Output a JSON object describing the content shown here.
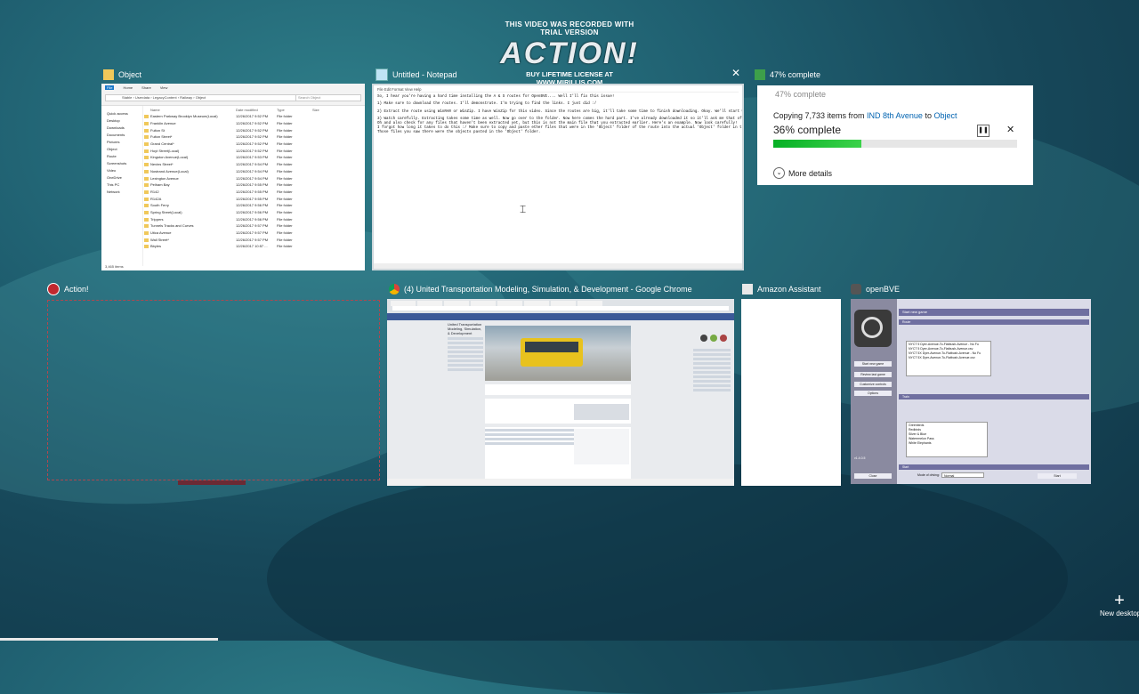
{
  "watermark": {
    "line1": "THIS VIDEO WAS RECORDED WITH TRIAL VERSION",
    "logo": "ACTION!",
    "line2": "BUY LIFETIME LICENSE AT WWW.MIRILLIS.COM"
  },
  "windows": {
    "explorer": {
      "title": "Object",
      "tabs": [
        "File",
        "Home",
        "Share",
        "View"
      ],
      "path": "Stable › Userdata › LegacyContent › Railway › Object",
      "search_placeholder": "Search Object",
      "sidebar": [
        "Quick access",
        "Desktop",
        "Downloads",
        "Documents",
        "Pictures",
        "Object",
        "Route",
        "Screenshots",
        "Video",
        "OneDrive",
        "This PC",
        "Network"
      ],
      "columns": [
        "Name",
        "Date modified",
        "Type",
        "Size"
      ],
      "rows": [
        [
          "Eastern Parkway Brooklyn Museum(Local)",
          "12/26/2017 9:52 PM",
          "File folder"
        ],
        [
          "Franklin Avenue",
          "12/26/2017 9:52 PM",
          "File folder"
        ],
        [
          "Fulton St",
          "12/26/2017 9:52 PM",
          "File folder"
        ],
        [
          "Fulton Street*",
          "12/26/2017 9:52 PM",
          "File folder"
        ],
        [
          "Grand Central*",
          "12/26/2017 9:52 PM",
          "File folder"
        ],
        [
          "Hoyt Street(Local)",
          "12/26/2017 9:52 PM",
          "File folder"
        ],
        [
          "Kingston Avenue(Local)",
          "12/26/2017 9:53 PM",
          "File folder"
        ],
        [
          "Nevins Street*",
          "12/26/2017 9:54 PM",
          "File folder"
        ],
        [
          "Nostrand Avenue(Local)",
          "12/26/2017 9:54 PM",
          "File folder"
        ],
        [
          "Lexington Avenue",
          "12/26/2017 9:54 PM",
          "File folder"
        ],
        [
          "Pelham Bay",
          "12/26/2017 9:55 PM",
          "File folder"
        ],
        [
          "R142",
          "12/26/2017 9:55 PM",
          "File folder"
        ],
        [
          "R142A",
          "12/26/2017 9:55 PM",
          "File folder"
        ],
        [
          "South Ferry",
          "12/26/2017 9:56 PM",
          "File folder"
        ],
        [
          "Spring Street(Local)",
          "12/26/2017 9:56 PM",
          "File folder"
        ],
        [
          "Trippers",
          "12/26/2017 9:56 PM",
          "File folder"
        ],
        [
          "Tunnels Tracks and Curves",
          "12/26/2017 9:57 PM",
          "File folder"
        ],
        [
          "Utica Avenue",
          "12/26/2017 9:57 PM",
          "File folder"
        ],
        [
          "Wall Street*",
          "12/26/2017 9:57 PM",
          "File folder"
        ],
        [
          "Bbyles",
          "12/26/2017 10:57 ...",
          "File folder"
        ]
      ],
      "status": "3,465 items"
    },
    "notepad": {
      "title": "Untitled - Notepad",
      "menu": "File  Edit  Format  View  Help",
      "lines": [
        "So, I hear you're having a hard time installing the A & S routes for OpenBVE.... Well I'll fix this issue!",
        "1) Make sure to download the routes. I'll demonstrate. I'm trying to find the links. I just did :/",
        "2) Extract the route using WinRAR or WinZip. I have WinZip for this video. Since the routes are big, it'll take some time to finish downloading. Okay. We'll start with the A s",
        "3) Watch carefully. Extracting takes some time as well. Now go over to the folder. Now here comes the hard part. I've already downloaded it so it'll ask me that often.",
        "Oh and also check for any files that haven't been extracted yet, but this is not the main file that you extracted earlier. Here's an example. Now look carefully!",
        "I forgot how long it takes to do this :/ Make sure to copy and paste ether files that were in the 'Object' folder of the route into the actual 'Object' folder in the game its",
        "Those files you saw there were the objects pasted in the 'Object' folder."
      ]
    },
    "copy": {
      "title": "47% complete",
      "prefix": "Copying 7,733 items from ",
      "from": "IND 8th Avenue",
      "mid": " to ",
      "to": "Object",
      "percent_text": "36% complete",
      "progress": 0.36,
      "more_details": "More details"
    },
    "action": {
      "title": "Action!"
    },
    "chrome": {
      "title": "(4) United Transportation Modeling, Simulation, & Development - Google Chrome",
      "group_name": "United Transportation Modeling, Simulation, & Development"
    },
    "amazon": {
      "title": "Amazon Assistant"
    },
    "openbve": {
      "title": "openBVE",
      "buttons": [
        "Start new game",
        "Review last game",
        "Customize controls",
        "Options",
        "Close"
      ],
      "sections": [
        "Start new game",
        "Route",
        "Train",
        "Start"
      ],
      "route_list": [
        "NYCT 5 Dyer-Avenue-To-Flatbush-Avenue - No Fu",
        "NYCT 5 Dyer-Avenue-To-Flatbush-Avenue.csv",
        "NYCT 5X Dyer-Avenue-To-Flatbush-Avenue - No Fu",
        "NYCT 5X Dyer-Avenue-To-Flatbush-Avenue.csv"
      ],
      "train_list": [
        "Greenbirds",
        "Redbirds",
        "Silver & Blue",
        "Waterrmelon Pass",
        "White Elephants"
      ],
      "mode_label": "Mode of driving:",
      "mode_value": "Normal",
      "start_label": "Start",
      "version": "v1.4.0.5"
    }
  },
  "new_desktop": {
    "label": "New desktop"
  },
  "colors": {
    "accent": "#0063b1",
    "progress": "#06b025"
  }
}
